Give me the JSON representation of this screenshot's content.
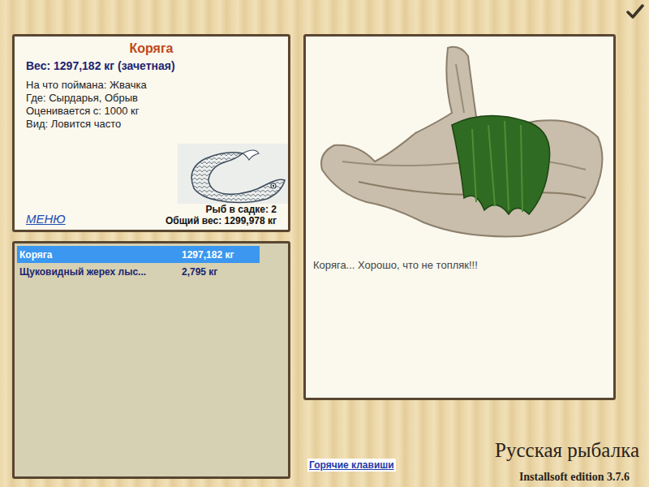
{
  "card": {
    "title": "Коряга",
    "weight": "Вес: 1297,182 кг (зачетная)",
    "details": [
      "На что поймана: Жвачка",
      "Где: Сырдарья, Обрыв",
      "Оценивается с: 1000 кг",
      "Вид: Ловится часто"
    ],
    "menu": "МЕНЮ",
    "fish_count": "Рыб в садке: 2",
    "total_weight": "Общий вес: 1299,978 кг"
  },
  "catch_list": [
    {
      "name": "Коряга",
      "weight": "1297,182 кг",
      "selected": true
    },
    {
      "name": "Щуковидный жерех лыс...",
      "weight": "2,795 кг",
      "selected": false
    }
  ],
  "description": "Коряга... Хорошо, что не топляк!!!",
  "hotkeys": "Горячие клавиши",
  "game_title": "Русская рыбалка",
  "edition": "Installsoft edition 3.7.6"
}
